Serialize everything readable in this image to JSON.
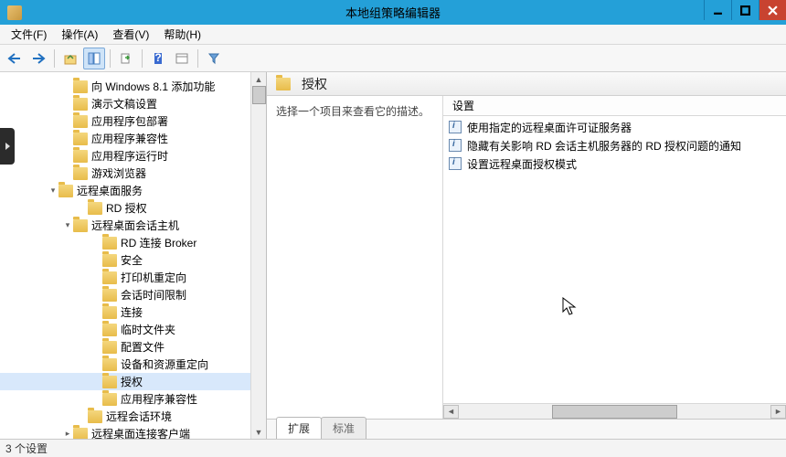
{
  "window": {
    "title": "本地组策略编辑器"
  },
  "menu": {
    "file": "文件(F)",
    "action": "操作(A)",
    "view": "查看(V)",
    "help": "帮助(H)"
  },
  "tree": [
    {
      "indent": 3,
      "exp": "",
      "label": "向 Windows 8.1 添加功能"
    },
    {
      "indent": 3,
      "exp": "",
      "label": "演示文稿设置"
    },
    {
      "indent": 3,
      "exp": "",
      "label": "应用程序包部署"
    },
    {
      "indent": 3,
      "exp": "",
      "label": "应用程序兼容性"
    },
    {
      "indent": 3,
      "exp": "",
      "label": "应用程序运行时"
    },
    {
      "indent": 3,
      "exp": "",
      "label": "游戏浏览器"
    },
    {
      "indent": 2,
      "exp": "▾",
      "label": "远程桌面服务"
    },
    {
      "indent": 4,
      "exp": "",
      "label": "RD 授权"
    },
    {
      "indent": 3,
      "exp": "▾",
      "label": "远程桌面会话主机"
    },
    {
      "indent": 5,
      "exp": "",
      "label": "RD 连接 Broker"
    },
    {
      "indent": 5,
      "exp": "",
      "label": "安全"
    },
    {
      "indent": 5,
      "exp": "",
      "label": "打印机重定向"
    },
    {
      "indent": 5,
      "exp": "",
      "label": "会话时间限制"
    },
    {
      "indent": 5,
      "exp": "",
      "label": "连接"
    },
    {
      "indent": 5,
      "exp": "",
      "label": "临时文件夹"
    },
    {
      "indent": 5,
      "exp": "",
      "label": "配置文件"
    },
    {
      "indent": 5,
      "exp": "",
      "label": "设备和资源重定向"
    },
    {
      "indent": 5,
      "exp": "",
      "label": "授权",
      "selected": true
    },
    {
      "indent": 5,
      "exp": "",
      "label": "应用程序兼容性"
    },
    {
      "indent": 4,
      "exp": "",
      "label": "远程会话环境"
    },
    {
      "indent": 3,
      "exp": "▸",
      "label": "远程桌面连接客户端"
    }
  ],
  "right": {
    "title": "授权",
    "prompt": "选择一个项目来查看它的描述。",
    "column": "设置",
    "items": [
      "使用指定的远程桌面许可证服务器",
      "隐藏有关影响 RD 会话主机服务器的 RD 授权问题的通知",
      "设置远程桌面授权模式"
    ]
  },
  "tabs": {
    "extended": "扩展",
    "standard": "标准"
  },
  "status": {
    "text": "3 个设置"
  }
}
